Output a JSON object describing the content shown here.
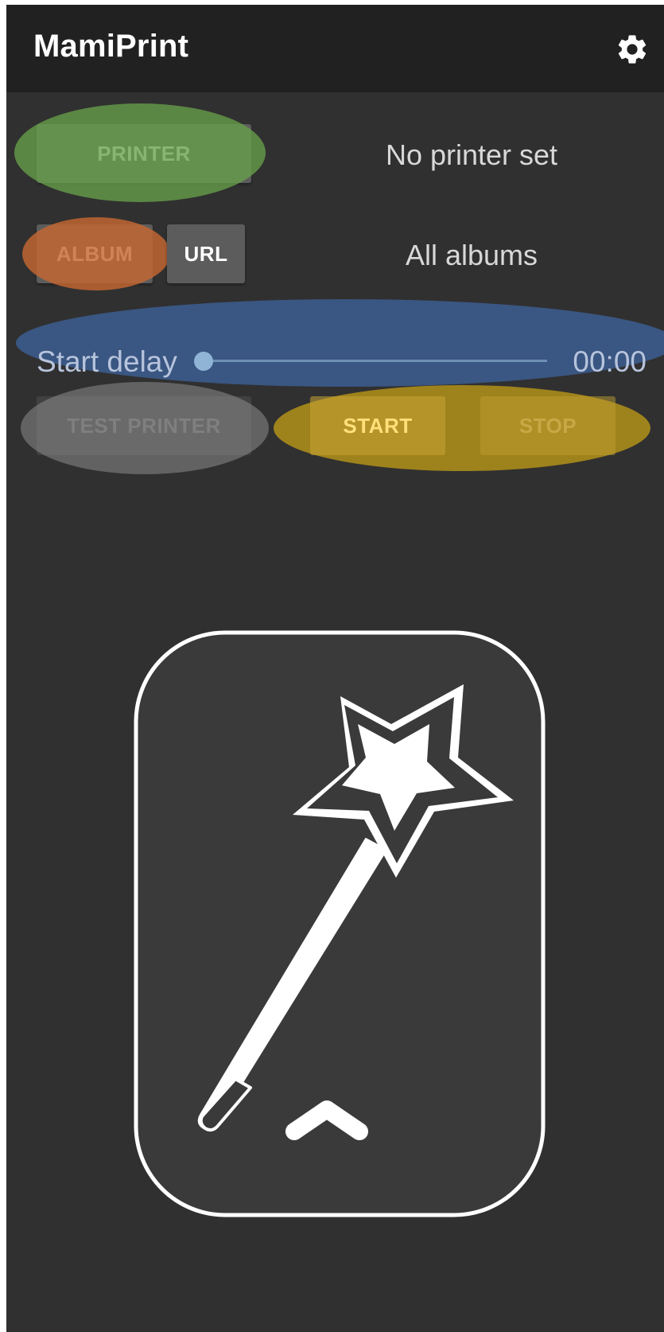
{
  "appbar": {
    "title": "MamiPrint",
    "settings_icon": "gear-icon"
  },
  "printer_row": {
    "button_label": "PRINTER",
    "status": "No printer set"
  },
  "album_row": {
    "album_label": "ALBUM",
    "url_label": "URL",
    "status": "All albums"
  },
  "delay_row": {
    "label": "Start delay",
    "value": "00:00",
    "slider_fraction": 0
  },
  "actions_row": {
    "test_label": "TEST PRINTER",
    "start_label": "START",
    "stop_label": "STOP"
  },
  "card": {
    "icon": "magic-wand-icon",
    "chevron_icon": "chevron-up-icon"
  },
  "colors": {
    "background": "#303030",
    "appbar": "#212121",
    "highlight_green": "#5e8f43",
    "highlight_orange": "#b86331",
    "highlight_blue": "#3c5a8a",
    "highlight_gray": "#8a8a8a",
    "highlight_gold": "#a88a1b"
  }
}
